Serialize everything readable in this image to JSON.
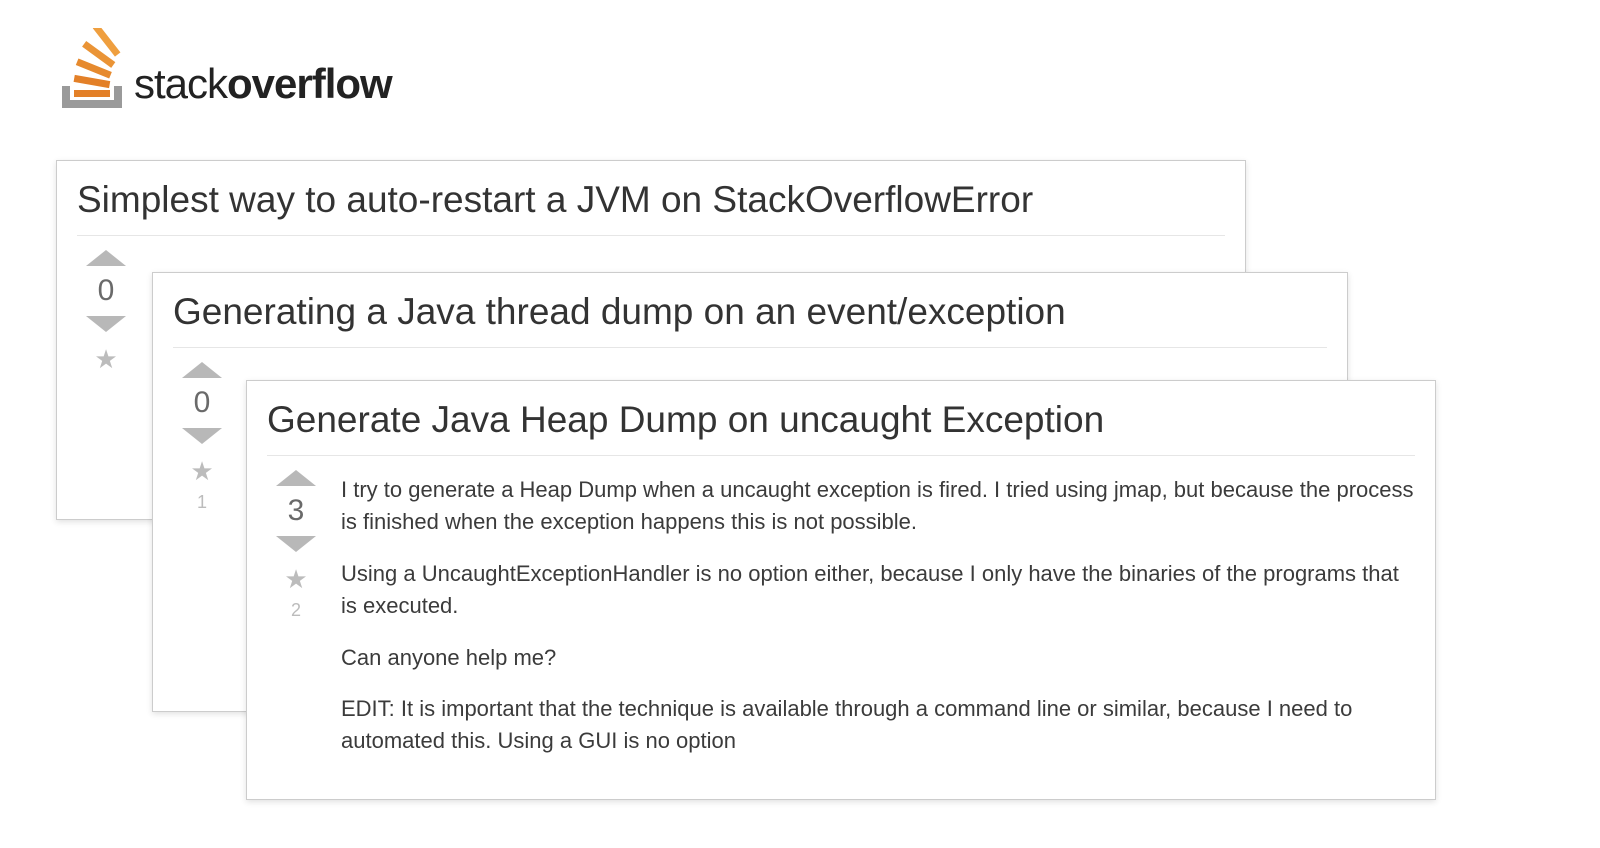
{
  "brand": {
    "word1": "stack",
    "word2": "overflow"
  },
  "cards": [
    {
      "title": "Simplest way to auto-restart a JVM on StackOverflowError",
      "votes": "0",
      "fav": ""
    },
    {
      "title": "Generating a Java thread dump on an event/exception",
      "votes": "0",
      "fav": "1"
    },
    {
      "title": "Generate Java Heap Dump on uncaught Exception",
      "votes": "3",
      "fav": "2",
      "body": [
        "I try to generate a Heap Dump when a uncaught exception is fired. I tried using jmap, but because the process is finished when the exception happens this is not possible.",
        "Using a UncaughtExceptionHandler is no option either, because I only have the binaries of the programs that is executed.",
        "Can anyone help me?",
        "EDIT: It is important that the technique is available through a command line or similar, because I need to automated this. Using a GUI is no option"
      ]
    }
  ]
}
